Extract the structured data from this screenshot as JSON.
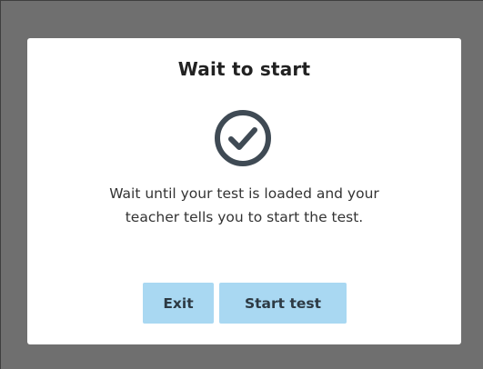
{
  "dialog": {
    "title": "Wait to start",
    "icon": "check-circle-icon",
    "message_line1": "Wait until your test is loaded and your",
    "message_line2": "teacher tells you to start the test.",
    "buttons": {
      "exit_label": "Exit",
      "start_label": "Start test"
    }
  },
  "colors": {
    "overlay": "#6f6f6f",
    "dialog_background": "#ffffff",
    "button_background": "#a9d8f2",
    "icon": "#3f4a54"
  }
}
